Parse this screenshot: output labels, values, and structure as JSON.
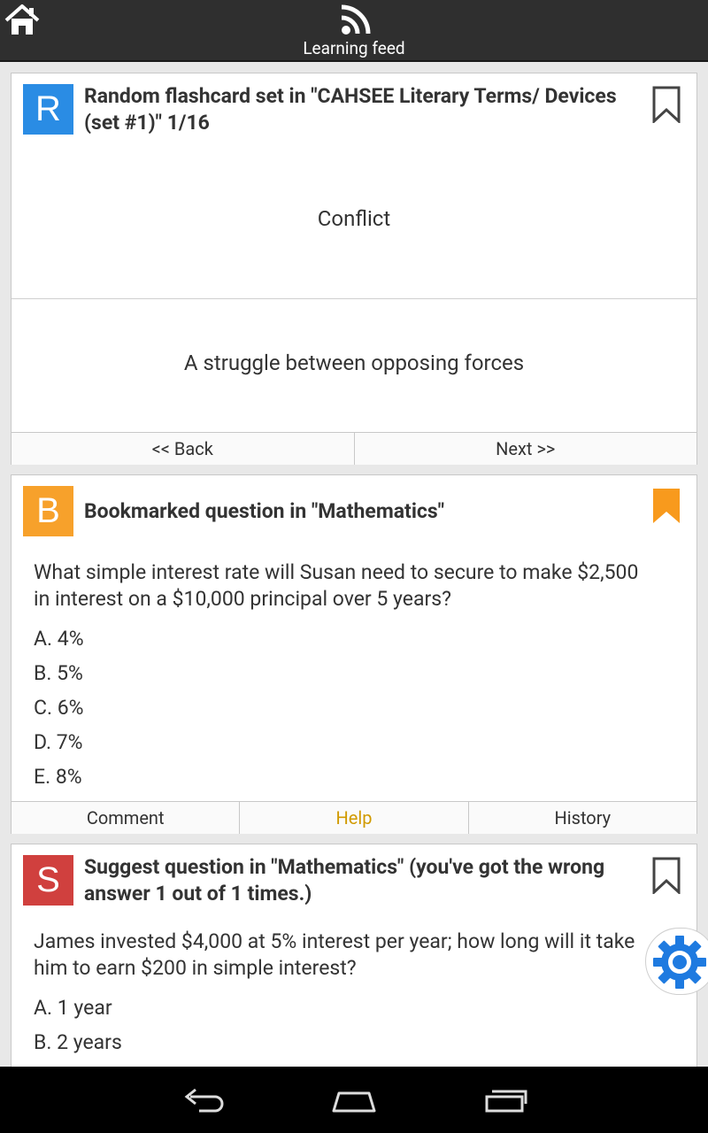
{
  "header": {
    "title": "Learning feed",
    "home_icon": "home-icon",
    "feed_icon": "rss-feed-icon"
  },
  "cards": [
    {
      "badge_letter": "R",
      "badge_color": "#2a8ce4",
      "title": "Random flashcard set in \"CAHSEE Literary Terms/ Devices (set #1)\" 1/16",
      "bookmarked": false,
      "front": "Conflict",
      "back": "A struggle between opposing forces",
      "buttons": {
        "back": "<< Back",
        "next": "Next >>"
      }
    },
    {
      "badge_letter": "B",
      "badge_color": "#f7a12b",
      "title": "Bookmarked question in \"Mathematics\"",
      "bookmarked": true,
      "bookmark_color": "#f89a1d",
      "question": "What simple interest rate will Susan need to secure to make $2,500 in interest on a $10,000 principal over 5 years?",
      "choices": [
        "A. 4%",
        "B. 5%",
        "C. 6%",
        "D. 7%",
        "E. 8%"
      ],
      "buttons": {
        "comment": "Comment",
        "help": "Help",
        "history": "History"
      }
    },
    {
      "badge_letter": "S",
      "badge_color": "#d0403e",
      "title": "Suggest question in \"Mathematics\" (you've got the wrong answer 1 out of 1 times.)",
      "bookmarked": false,
      "question": "James invested $4,000 at 5% interest per year; how long will it take him to earn $200 in simple interest?",
      "choices": [
        "A. 1 year",
        "B. 2 years"
      ]
    }
  ],
  "fab": {
    "icon": "gear-icon",
    "color": "#1e7ae0"
  },
  "navbar": {
    "back_icon": "back-icon",
    "home_icon": "home-nav-icon",
    "recents_icon": "recent-apps-icon"
  }
}
